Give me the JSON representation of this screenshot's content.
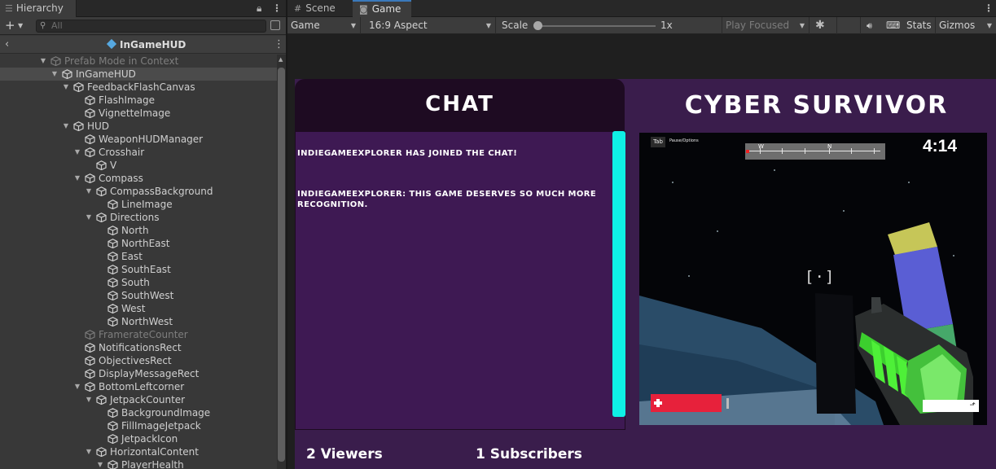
{
  "hierarchy": {
    "tab_label": "Hierarchy",
    "search_placeholder": "All",
    "prefab_title": "InGameHUD",
    "rows": [
      {
        "label": "Prefab Mode in Context"
      },
      {
        "label": "InGameHUD"
      },
      {
        "label": "FeedbackFlashCanvas"
      },
      {
        "label": "FlashImage"
      },
      {
        "label": "VignetteImage"
      },
      {
        "label": "HUD"
      },
      {
        "label": "WeaponHUDManager"
      },
      {
        "label": "Crosshair"
      },
      {
        "label": "V"
      },
      {
        "label": "Compass"
      },
      {
        "label": "CompassBackground"
      },
      {
        "label": "LineImage"
      },
      {
        "label": "Directions"
      },
      {
        "label": "North"
      },
      {
        "label": "NorthEast"
      },
      {
        "label": "East"
      },
      {
        "label": "SouthEast"
      },
      {
        "label": "South"
      },
      {
        "label": "SouthWest"
      },
      {
        "label": "West"
      },
      {
        "label": "NorthWest"
      },
      {
        "label": "FramerateCounter"
      },
      {
        "label": "NotificationsRect"
      },
      {
        "label": "ObjectivesRect"
      },
      {
        "label": "DisplayMessageRect"
      },
      {
        "label": "BottomLeftcorner"
      },
      {
        "label": "JetpackCounter"
      },
      {
        "label": "BackgroundImage"
      },
      {
        "label": "FillImageJetpack"
      },
      {
        "label": "JetpackIcon"
      },
      {
        "label": "HorizontalContent"
      },
      {
        "label": "PlayerHealth"
      }
    ]
  },
  "game_view": {
    "tabs": [
      {
        "label": "Scene",
        "icon": "grid-icon"
      },
      {
        "label": "Game",
        "icon": "gamepad-icon"
      }
    ],
    "toolbar": {
      "display": "Game",
      "aspect": "16:9 Aspect",
      "scale_label": "Scale",
      "scale_value": "1x",
      "play_mode": "Play Focused",
      "stats": "Stats",
      "gizmos": "Gizmos"
    }
  },
  "hud": {
    "chat_title": "CHAT",
    "messages": [
      "IndieGameExplorer has joined the chat!",
      "IndieGameExplorer: This game deserves so much more recognition."
    ],
    "viewers": "2 Viewers",
    "subscribers": "1 Subscribers",
    "game_title": "CYBER SURVIVOR",
    "screen": {
      "tab_key": "Tab",
      "pause_hint": "Pause/Options",
      "timer": "4:14",
      "compass_dirs": [
        "W",
        "N"
      ]
    }
  },
  "colors": {
    "panel_bg": "#383838",
    "hud_bg": "#3a1d4c",
    "chat_bg": "#3e1953",
    "chat_header_bg": "#1e0b22",
    "scrollbar": "#0ff0e6",
    "health": "#e7213b"
  }
}
